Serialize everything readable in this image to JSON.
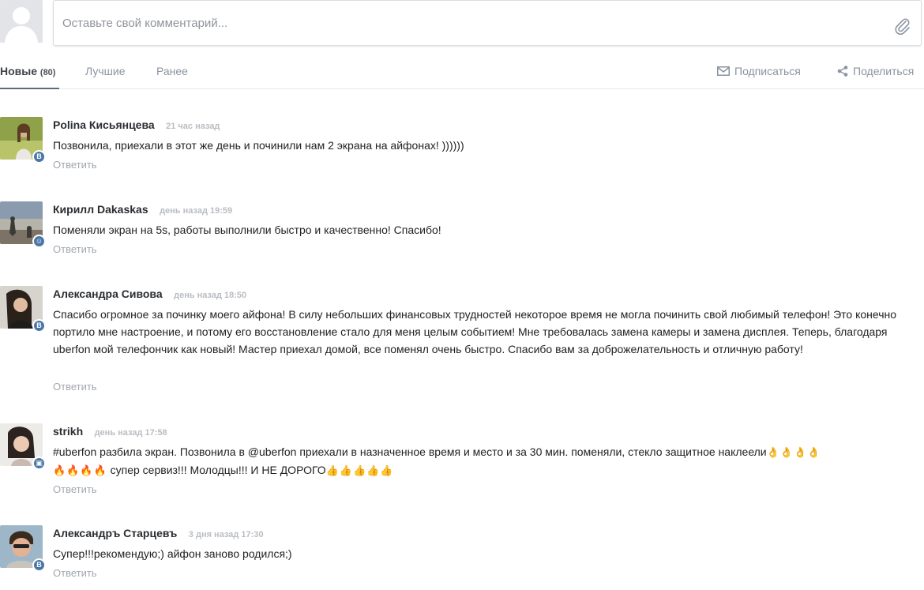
{
  "composer": {
    "placeholder": "Оставьте свой комментарий..."
  },
  "tabs": [
    {
      "label": "Новые",
      "count": "(80)",
      "active": true
    },
    {
      "label": "Лучшие"
    },
    {
      "label": "Ранее"
    }
  ],
  "actions": {
    "subscribe": "Подписаться",
    "share": "Поделиться"
  },
  "comments": [
    {
      "author": "Polina Кисьянцева",
      "time": "21 час назад",
      "text": "Позвонила, приехали в этот же день и починили нам 2 экрана на айфонах! ))))))",
      "reply": "Ответить",
      "badge": "В"
    },
    {
      "author": "Кирилл Dakaskas",
      "time": "день назад 19:59",
      "text": "Поменяли экран на 5s, работы выполнили быстро и качественно! Спасибо!",
      "reply": "Ответить",
      "badge": "☺"
    },
    {
      "author": "Александра Сивова",
      "time": "день назад 18:50",
      "text": "Спасибо огромное за починку моего айфона! В силу небольших финансовых трудностей некоторое время не могла починить свой любимый телефон! Это конечно портило мне настроение, и потому его восстановление стало для меня целым событием! Мне требовалась замена камеры и замена дисплея. Теперь, благодаря uberfon мой телефончик как новый! Мастер приехал домой, все поменял очень быстро. Спасибо вам за доброжелательность и отличную работу!",
      "reply": "Ответить",
      "badge": "В"
    },
    {
      "author": "strikh",
      "time": "день назад 17:58",
      "text": "#uberfon разбила экран. Позвонила в @uberfon приехали в назначенное время и место и за 30 мин. поменяли, стекло защитное наклеели",
      "emoji_ok": "👌👌👌👌",
      "emoji_fire": "🔥🔥🔥🔥",
      "text2": " супер сервиз!!! Молодцы!!! И НЕ ДОРОГО",
      "emoji_thumbs": "👍👍👍👍👍",
      "reply": "Ответить",
      "badge": "▣"
    },
    {
      "author": "Александръ Старцевъ",
      "time": "3 дня назад 17:30",
      "text": "Супер!!!рекомендую;) айфон заново родился;)",
      "reply": "Ответить",
      "badge": "В"
    }
  ]
}
